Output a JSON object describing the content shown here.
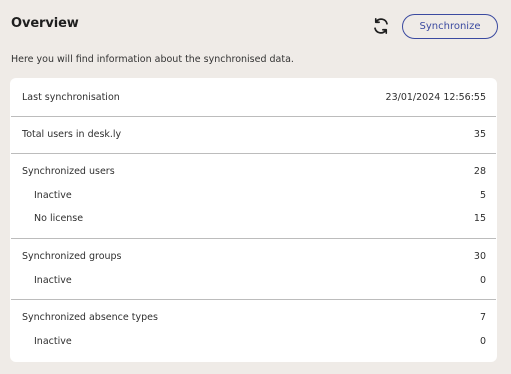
{
  "header": {
    "title": "Overview",
    "refresh_icon": "refresh-icon",
    "sync_button_label": "Synchronize"
  },
  "description": "Here you will find information about the synchronised data.",
  "rows": {
    "last_sync": {
      "label": "Last synchronisation",
      "value": "23/01/2024 12:56:55"
    },
    "total_users": {
      "label": "Total users in desk.ly",
      "value": "35"
    },
    "synced_users": {
      "label": "Synchronized users",
      "value": "28"
    },
    "synced_users_inactive": {
      "label": "Inactive",
      "value": "5"
    },
    "synced_users_no_license": {
      "label": "No license",
      "value": "15"
    },
    "synced_groups": {
      "label": "Synchronized groups",
      "value": "30"
    },
    "synced_groups_inactive": {
      "label": "Inactive",
      "value": "0"
    },
    "synced_absence_types": {
      "label": "Synchronized absence types",
      "value": "7"
    },
    "synced_absence_types_inactive": {
      "label": "Inactive",
      "value": "0"
    }
  },
  "colors": {
    "background": "#efebe7",
    "card": "#ffffff",
    "accent": "#3b4aa0",
    "divider": "#bcbcbc"
  }
}
